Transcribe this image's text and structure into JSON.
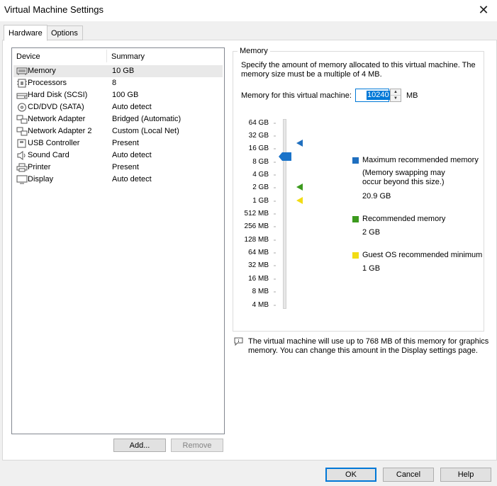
{
  "window": {
    "title": "Virtual Machine Settings",
    "close_icon": "close-icon"
  },
  "tabs": [
    {
      "label": "Hardware",
      "active": true
    },
    {
      "label": "Options",
      "active": false
    }
  ],
  "device_list": {
    "columns": {
      "device": "Device",
      "summary": "Summary"
    },
    "rows": [
      {
        "icon": "memory-icon",
        "name": "Memory",
        "summary": "10 GB",
        "selected": true
      },
      {
        "icon": "processor-icon",
        "name": "Processors",
        "summary": "8"
      },
      {
        "icon": "hard-disk-icon",
        "name": "Hard Disk (SCSI)",
        "summary": "100 GB"
      },
      {
        "icon": "cd-dvd-icon",
        "name": "CD/DVD (SATA)",
        "summary": "Auto detect"
      },
      {
        "icon": "network-adapter-icon",
        "name": "Network Adapter",
        "summary": "Bridged (Automatic)"
      },
      {
        "icon": "network-adapter-icon",
        "name": "Network Adapter 2",
        "summary": "Custom (Local Net)"
      },
      {
        "icon": "usb-icon",
        "name": "USB Controller",
        "summary": "Present"
      },
      {
        "icon": "sound-card-icon",
        "name": "Sound Card",
        "summary": "Auto detect"
      },
      {
        "icon": "printer-icon",
        "name": "Printer",
        "summary": "Present"
      },
      {
        "icon": "display-icon",
        "name": "Display",
        "summary": "Auto detect"
      }
    ],
    "add_label": "Add...",
    "remove_label": "Remove"
  },
  "memory": {
    "group_title": "Memory",
    "description_line1": "Specify the amount of memory allocated to this virtual machine. The",
    "description_line2": "memory size must be a multiple of 4 MB.",
    "field_label": "Memory for this virtual machine:",
    "value": "10240",
    "unit": "MB",
    "scale": [
      "64 GB",
      "32 GB",
      "16 GB",
      "8 GB",
      "4 GB",
      "2 GB",
      "1 GB",
      "512 MB",
      "256 MB",
      "128 MB",
      "64 MB",
      "32 MB",
      "16 MB",
      "8 MB",
      "4 MB"
    ],
    "legend": {
      "max": {
        "title": "Maximum recommended memory",
        "note_line1": "(Memory swapping may",
        "note_line2": "occur beyond this size.)",
        "value": "20.9 GB",
        "color": "#1f6fbf"
      },
      "recommended": {
        "title": "Recommended memory",
        "value": "2 GB",
        "color": "#3c9a1e"
      },
      "guest_min": {
        "title": "Guest OS recommended minimum",
        "value": "1 GB",
        "color": "#f2dc14"
      }
    },
    "info_line1": "The virtual machine will use up to 768 MB of this memory for graphics",
    "info_line2": "memory. You can change this amount in the Display settings page."
  },
  "footer": {
    "ok": "OK",
    "cancel": "Cancel",
    "help": "Help"
  }
}
